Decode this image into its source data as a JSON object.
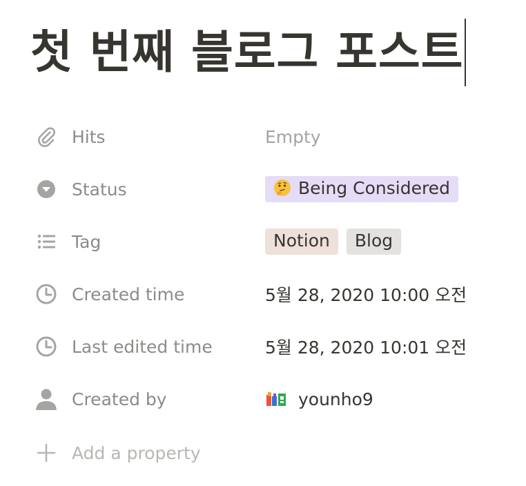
{
  "page": {
    "title": "첫 번째 블로그 포스트"
  },
  "properties": [
    {
      "name": "Hits",
      "icon": "attachment-icon",
      "value": "Empty"
    },
    {
      "name": "Status",
      "icon": "select-icon",
      "value": "Being Considered",
      "value_icon": "thinking-face-emoji",
      "color": "#e5dcf7"
    },
    {
      "name": "Tag",
      "icon": "list-icon",
      "tags": [
        {
          "label": "Notion",
          "color": "#eee0da"
        },
        {
          "label": "Blog",
          "color": "#e3e2e0"
        }
      ]
    },
    {
      "name": "Created time",
      "icon": "clock-icon",
      "value": "5월 28, 2020 10:00 오전"
    },
    {
      "name": "Last edited time",
      "icon": "clock-icon",
      "value": "5월 28, 2020 10:01 오전"
    },
    {
      "name": "Created by",
      "icon": "person-icon",
      "value": "younho9",
      "value_icon": "user-avatar"
    }
  ],
  "add_property": {
    "label": "Add a property",
    "icon": "plus-icon"
  },
  "colors": {
    "text": "#37352f",
    "muted": "#8c8b87",
    "icon": "#a5a4a0"
  }
}
